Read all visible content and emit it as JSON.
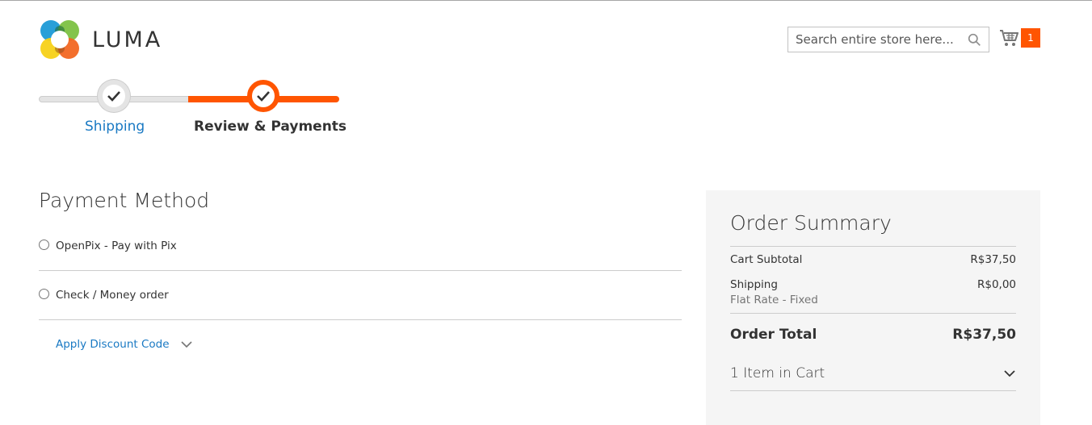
{
  "header": {
    "logo_text": "LUMA",
    "search_placeholder": "Search entire store here...",
    "cart_count": "1"
  },
  "progress": {
    "steps": [
      {
        "label": "Shipping",
        "status": "complete"
      },
      {
        "label": "Review & Payments",
        "status": "active"
      }
    ]
  },
  "payment": {
    "title": "Payment Method",
    "methods": [
      {
        "label": "OpenPix - Pay with Pix",
        "selected": false
      },
      {
        "label": "Check / Money order",
        "selected": false
      }
    ],
    "discount_label": "Apply Discount Code"
  },
  "summary": {
    "title": "Order Summary",
    "subtotal_label": "Cart Subtotal",
    "subtotal_value": "R$37,50",
    "shipping_label": "Shipping",
    "shipping_value": "R$0,00",
    "shipping_method": "Flat Rate - Fixed",
    "total_label": "Order Total",
    "total_value": "R$37,50",
    "items_label": "1 Item in Cart"
  },
  "colors": {
    "accent": "#ff5501",
    "link": "#1979c3",
    "summary_bg": "#f5f5f5"
  }
}
